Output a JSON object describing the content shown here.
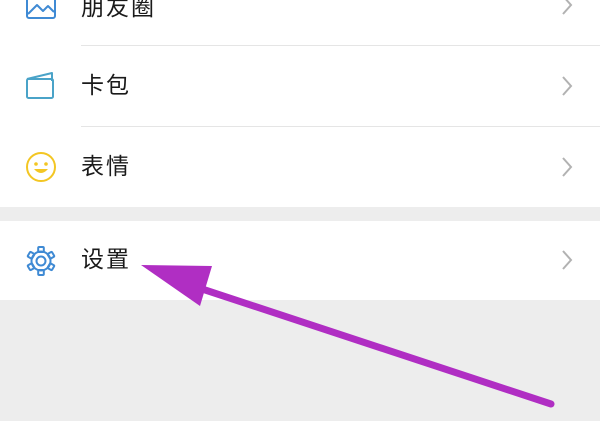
{
  "menu": {
    "items": [
      {
        "label": "朋友圈",
        "icon": "album-icon"
      },
      {
        "label": "卡包",
        "icon": "card-wallet-icon"
      },
      {
        "label": "表情",
        "icon": "smiley-face-icon"
      },
      {
        "label": "设置",
        "icon": "gear-icon"
      }
    ]
  },
  "colors": {
    "page_background": "#ededed",
    "row_background": "#ffffff",
    "icon_blue": "#3f8ad4",
    "icon_teal": "#4aa3c8",
    "icon_yellow": "#f3c623",
    "annotation_arrow": "#b02ec3"
  }
}
